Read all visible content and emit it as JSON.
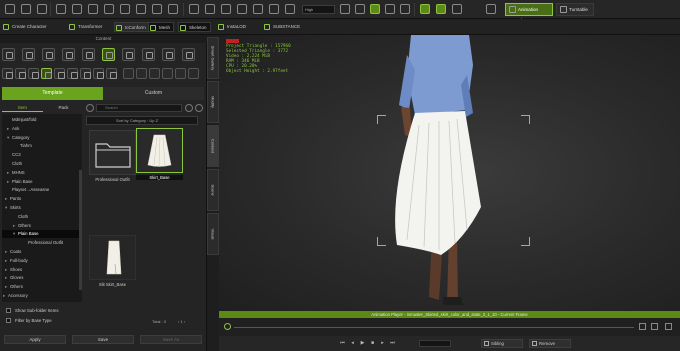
{
  "toolbar": {
    "quality_dropdown": "High",
    "animation_player_label": "Animation Player",
    "turntable_label": "Turntable"
  },
  "toolbar2": {
    "create_character": "Create Character",
    "transformer": "Transformer",
    "iconform": "IcConform",
    "mesh": "Mesh",
    "skeleton": "Skeleton",
    "instalod": "InstaLOD",
    "substance": "SUBSTANCE"
  },
  "panel": {
    "title": "Content",
    "tabs": [
      "Template",
      "Custom"
    ],
    "subtabs": [
      "Item",
      "Pack"
    ],
    "search_placeholder": "Search",
    "sort_label": "Sort by Category : Up Z",
    "tree": [
      {
        "label": "Mdmjust/fold",
        "indent": 5,
        "arrow": ""
      },
      {
        "label": "Ank",
        "indent": 5,
        "arrow": "▸"
      },
      {
        "label": "Category",
        "indent": 5,
        "arrow": "▾"
      },
      {
        "label": "Tiahm",
        "indent": 13,
        "arrow": ""
      },
      {
        "label": "CC3",
        "indent": 5,
        "arrow": ""
      },
      {
        "label": "Cloth",
        "indent": 5,
        "arrow": ""
      },
      {
        "label": "MHNS",
        "indent": 5,
        "arrow": "▸"
      },
      {
        "label": "Plain Base",
        "indent": 5,
        "arrow": "▸"
      },
      {
        "label": "Playset→Asseasne",
        "indent": 5,
        "arrow": ""
      },
      {
        "label": "Pants",
        "indent": 3,
        "arrow": "▸"
      },
      {
        "label": "Skirts",
        "indent": 3,
        "arrow": "▾"
      },
      {
        "label": "Cloth",
        "indent": 11,
        "arrow": ""
      },
      {
        "label": "Others",
        "indent": 11,
        "arrow": "▸"
      },
      {
        "label": "Plain Base",
        "indent": 11,
        "arrow": "▾",
        "selected": true
      },
      {
        "label": "Professional Outfit",
        "indent": 21,
        "arrow": ""
      },
      {
        "label": "Coats",
        "indent": 3,
        "arrow": "▸"
      },
      {
        "label": "Full-body",
        "indent": 3,
        "arrow": "▸"
      },
      {
        "label": "Shoes",
        "indent": 3,
        "arrow": "▸"
      },
      {
        "label": "Gloves",
        "indent": 3,
        "arrow": "▸"
      },
      {
        "label": "Others",
        "indent": 3,
        "arrow": "▸"
      },
      {
        "label": "Accessory",
        "indent": 1,
        "arrow": "▸"
      }
    ],
    "grid_items": [
      {
        "label": "Professional Outfit",
        "kind": "folder"
      },
      {
        "label": "Skirt_Base",
        "kind": "skirt",
        "selected": true
      },
      {
        "label": "Slit Skirt_Base",
        "kind": "slit"
      }
    ],
    "total_label": "Total : 3",
    "checkboxes": [
      "Show Sub-folder Items",
      "Filter by Base Type"
    ],
    "buttons": [
      "Apply",
      "Save",
      "Save As"
    ]
  },
  "side_tabs": [
    "Smart Gallery",
    "Modify",
    "Content",
    "Scene",
    "Visual"
  ],
  "viewport": {
    "stats": [
      "Project Triangle : 157960",
      "Selected Triangle : 3772",
      "Video : 2,224 MiB",
      "RAM : 346 MiB",
      "CPU : 20.28%",
      "Object Height : 2.97feet"
    ]
  },
  "animation_player": {
    "title": "Animation Player - Inmaster_Skirted_skirt_color_and_state_3_1_10 - Current Frame",
    "sibling": "Sibling",
    "remove": "Remove"
  }
}
